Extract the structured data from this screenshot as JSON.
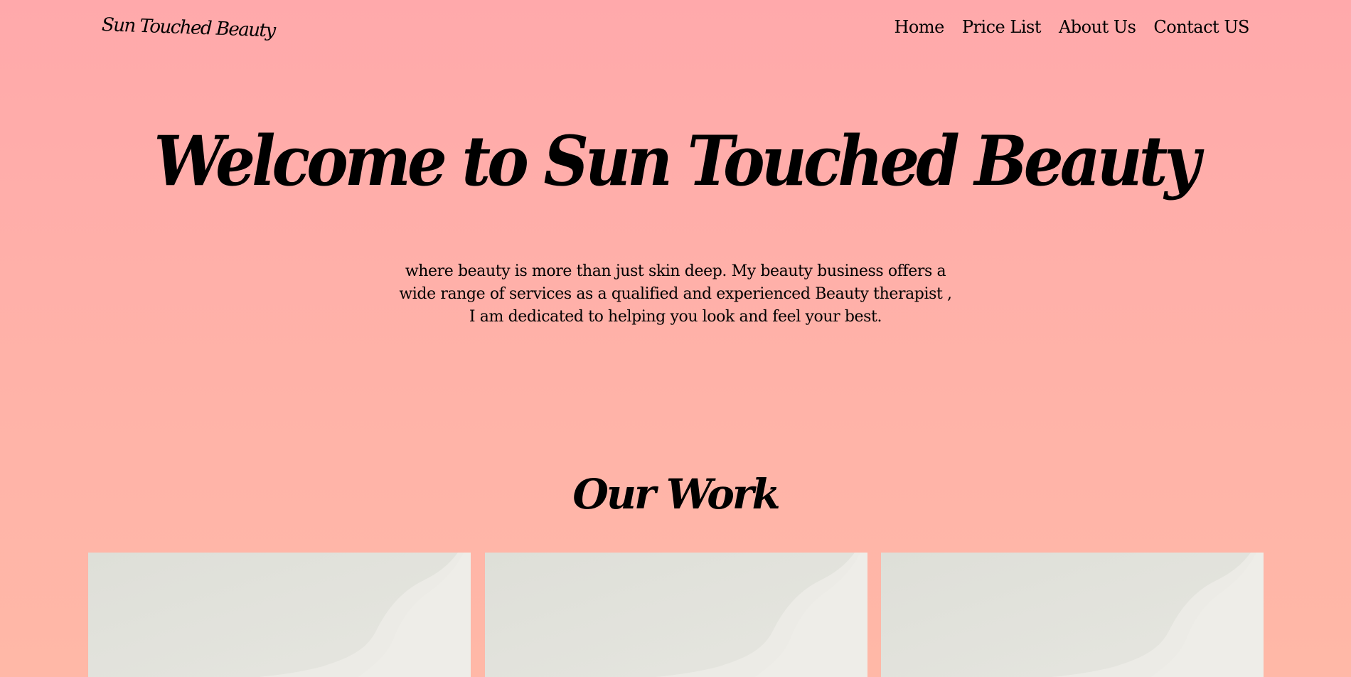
{
  "navbar": {
    "brand": "Sun Touched Beauty",
    "links": [
      {
        "label": "Home"
      },
      {
        "label": "Price List"
      },
      {
        "label": "About Us"
      },
      {
        "label": "Contact US"
      }
    ]
  },
  "hero": {
    "title": "Welcome to Sun Touched Beauty",
    "text_lines": [
      "where beauty is more than just skin deep. My beauty business offers a",
      "wide range of services as a qualified and experienced Beauty therapist ,",
      "I am dedicated to helping you look and feel your best."
    ]
  },
  "work": {
    "title": "Our Work",
    "items": [
      {
        "image": "work-photo"
      },
      {
        "image": "work-photo"
      },
      {
        "image": "work-photo"
      }
    ]
  },
  "colors": {
    "background_top": "#ffa9ab",
    "background_bottom": "#ffb8a7",
    "text": "#000000",
    "card": "#e1e1dc"
  }
}
